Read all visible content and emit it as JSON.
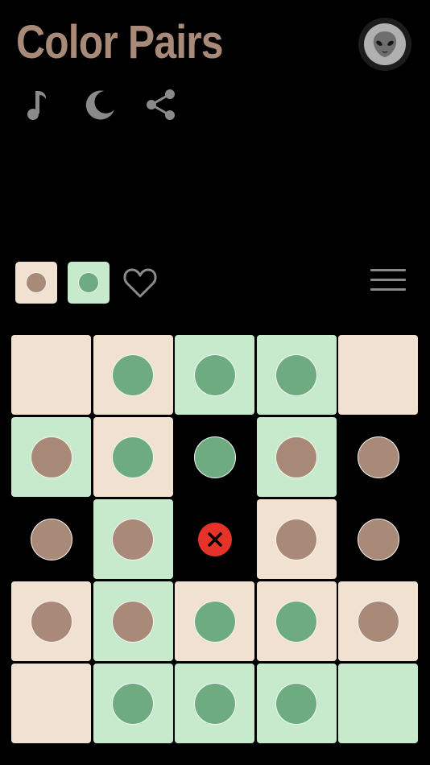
{
  "header": {
    "title": "Color Pairs",
    "avatar_icon": "alien-icon"
  },
  "toolbar": {
    "icons": [
      "music-note-icon",
      "moon-icon",
      "share-icon"
    ]
  },
  "palette": {
    "swatches": [
      {
        "name": "tan",
        "tile": "#f0e1d1",
        "dot": "#a98a78"
      },
      {
        "name": "green",
        "tile": "#c6eacb",
        "dot": "#6fab80"
      }
    ],
    "favorite_icon": "heart-outline-icon",
    "menu_icon": "hamburger-menu-icon"
  },
  "colors": {
    "tile_tan": "#f0e1d1",
    "tile_green": "#c6eacb",
    "piece_brown": "#a98a78",
    "piece_green": "#6fab80",
    "error_red": "#e6332a",
    "title": "#a98a78"
  },
  "board": {
    "rows": 5,
    "cols": 5,
    "cells": [
      [
        {
          "tile": "tan",
          "piece": null
        },
        {
          "tile": "tan",
          "piece": "green"
        },
        {
          "tile": "green",
          "piece": "green"
        },
        {
          "tile": "green",
          "piece": "green"
        },
        {
          "tile": "tan",
          "piece": null
        }
      ],
      [
        {
          "tile": "green",
          "piece": "brown"
        },
        {
          "tile": "tan",
          "piece": "green"
        },
        {
          "tile": null,
          "piece": "green"
        },
        {
          "tile": "green",
          "piece": "brown"
        },
        {
          "tile": null,
          "piece": "brown"
        }
      ],
      [
        {
          "tile": null,
          "piece": "brown"
        },
        {
          "tile": "green",
          "piece": "brown"
        },
        {
          "tile": null,
          "piece": "x"
        },
        {
          "tile": "tan",
          "piece": "brown"
        },
        {
          "tile": null,
          "piece": "brown"
        }
      ],
      [
        {
          "tile": "tan",
          "piece": "brown"
        },
        {
          "tile": "green",
          "piece": "brown"
        },
        {
          "tile": "tan",
          "piece": "green"
        },
        {
          "tile": "tan",
          "piece": "green"
        },
        {
          "tile": "tan",
          "piece": "brown"
        }
      ],
      [
        {
          "tile": "tan",
          "piece": null
        },
        {
          "tile": "green",
          "piece": "green"
        },
        {
          "tile": "green",
          "piece": "green"
        },
        {
          "tile": "green",
          "piece": "green"
        },
        {
          "tile": "green",
          "piece": null
        }
      ]
    ]
  }
}
